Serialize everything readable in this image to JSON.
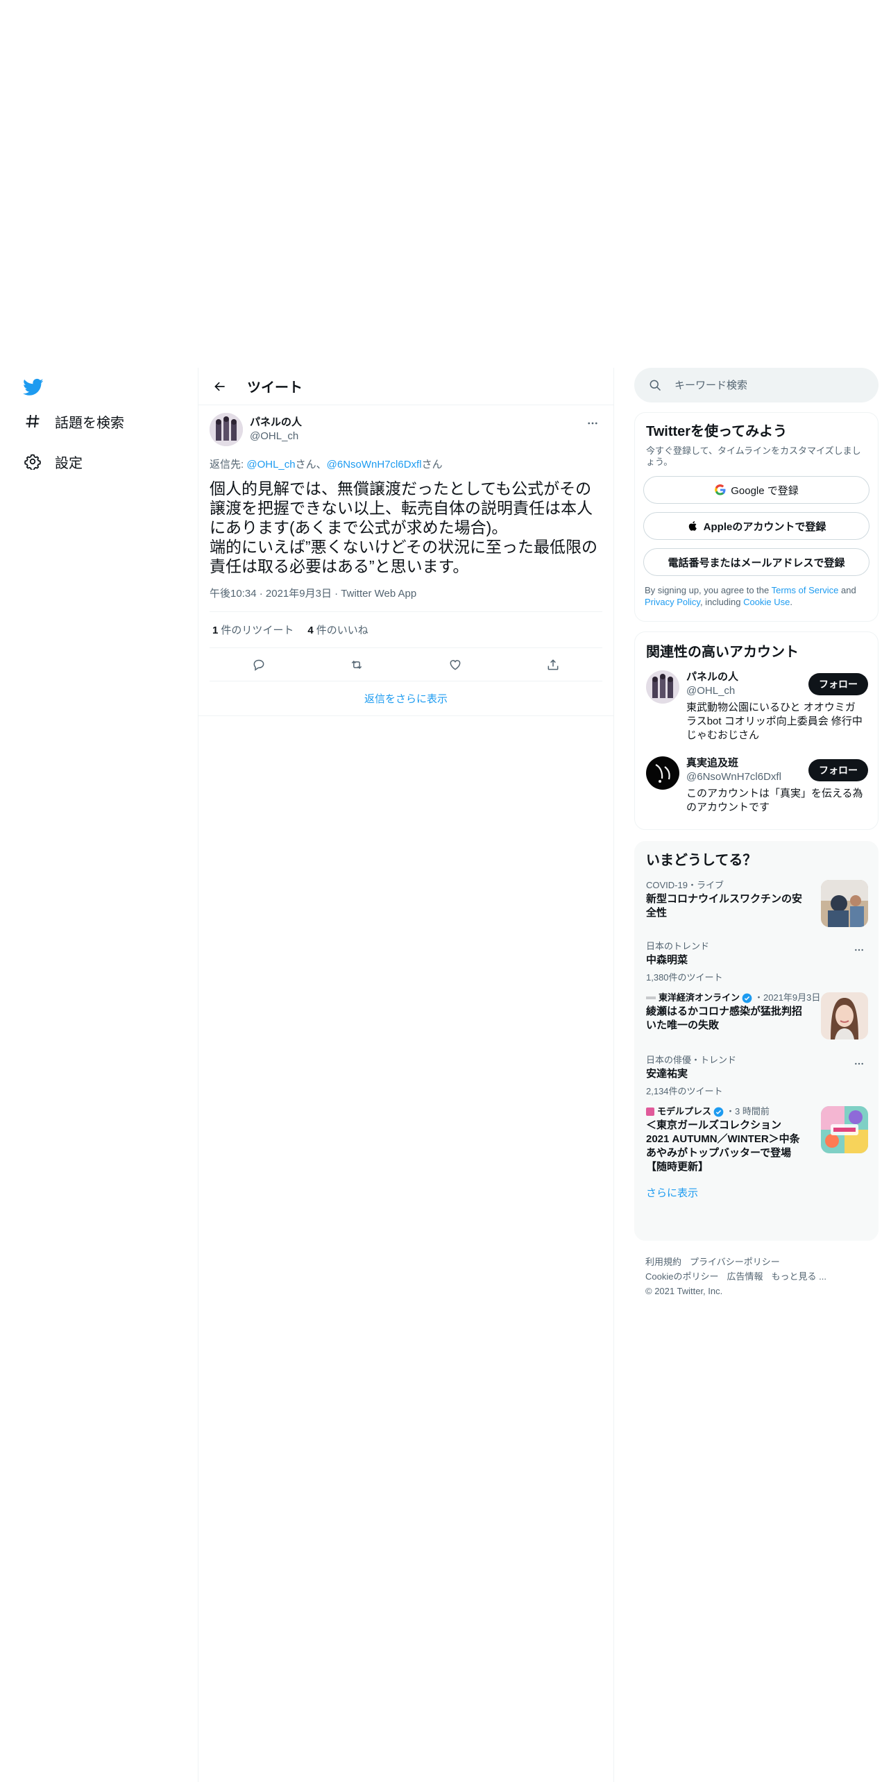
{
  "nav": {
    "logo": "twitter-bird-icon",
    "items": [
      {
        "label": "話題を検索",
        "icon": "hashtag-icon"
      },
      {
        "label": "設定",
        "icon": "gear-icon"
      }
    ]
  },
  "main": {
    "header_title": "ツイート",
    "tweet": {
      "author_name": "パネルの人",
      "author_handle": "@OHL_ch",
      "reply_prefix": "返信先: ",
      "reply_user1": "@OHL_ch",
      "reply_san1": "さん、",
      "reply_user2": "@6NsoWnH7cl6Dxfl",
      "reply_san2": "さん",
      "text": "個人的見解では、無償譲渡だったとしても公式がその譲渡を把握できない以上、転売自体の説明責任は本人にあります(あくまで公式が求めた場合)。\n端的にいえば”悪くないけどその状況に至った最低限の責任は取る必要はある”と思います。",
      "time": "午後10:34",
      "date": "2021年9月3日",
      "source": "Twitter Web App",
      "retweets_count": "1",
      "retweets_label": "件のリツイート",
      "likes_count": "4",
      "likes_label": "件のいいね"
    },
    "show_more_replies": "返信をさらに表示"
  },
  "right": {
    "search_placeholder": "キーワード検索",
    "signup": {
      "title": "Twitterを使ってみよう",
      "subtitle": "今すぐ登録して、タイムラインをカスタマイズしましょう。",
      "google": "Google で登録",
      "apple": "Appleのアカウントで登録",
      "phone": "電話番号またはメールアドレスで登録",
      "legal_1": "By signing up, you agree to the ",
      "legal_tos": "Terms of Service",
      "legal_2": " and ",
      "legal_pp": "Privacy Policy",
      "legal_3": ", including ",
      "legal_cookie": "Cookie Use",
      "legal_4": "."
    },
    "related": {
      "title": "関連性の高いアカウント",
      "follow_label": "フォロー",
      "accounts": [
        {
          "name": "パネルの人",
          "handle": "@OHL_ch",
          "bio": "東武動物公園にいるひと オオウミガラスbot コオリッポ向上委員会 修行中じゃむおじさん"
        },
        {
          "name": "真実追及班",
          "handle": "@6NsoWnH7cl6Dxfl",
          "bio": "このアカウントは「真実」を伝える為のアカウントです"
        }
      ]
    },
    "trends": {
      "title": "いまどうしてる？",
      "items": [
        {
          "context": "COVID-19・ライブ",
          "title": "新型コロナウイルスワクチンの安全性"
        },
        {
          "context": "日本のトレンド",
          "title": "中森明菜",
          "count": "1,380件のツイート"
        },
        {
          "source": "東洋経済オンライン",
          "time": "・2021年9月3日",
          "title": "綾瀬はるかコロナ感染が猛批判招いた唯一の失敗"
        },
        {
          "context": "日本の俳優・トレンド",
          "title": "安達祐実",
          "count": "2,134件のツイート"
        },
        {
          "source": "モデルプレス",
          "time": "・3 時間前",
          "title": "＜東京ガールズコレクション 2021 AUTUMN／WINTER＞中条あやみがトップバッターで登場【随時更新】"
        }
      ],
      "show_more": "さらに表示"
    },
    "footer": {
      "terms": "利用規約",
      "privacy": "プライバシーポリシー",
      "cookie": "Cookieのポリシー",
      "ads": "広告情報",
      "more": "もっと見る ...",
      "copyright": "© 2021 Twitter, Inc."
    }
  }
}
